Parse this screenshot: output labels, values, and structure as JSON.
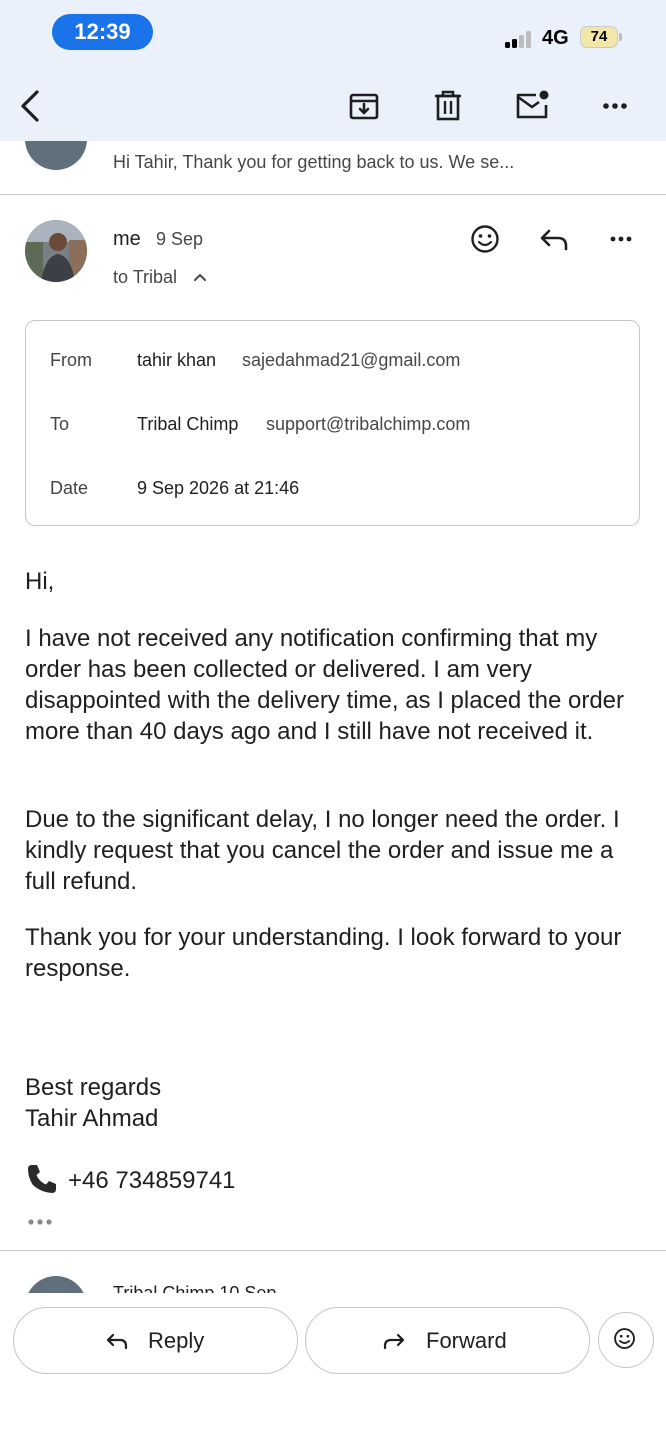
{
  "status_bar": {
    "time": "12:39",
    "network": "4G",
    "battery": "74"
  },
  "toolbar": {
    "back_icon": "chevron-left-icon",
    "archive_icon": "archive-icon",
    "delete_icon": "trash-icon",
    "mark_unread_icon": "mail-unread-icon",
    "more_icon": "more-horizontal-icon"
  },
  "previous_message": {
    "snippet": "Hi Tahir, Thank you for getting back to us. We se..."
  },
  "message": {
    "sender": "me",
    "date": "9 Sep",
    "recipient_summary": "to Tribal",
    "details": {
      "from_label": "From",
      "from_name": "tahir khan",
      "from_email": "sajedahmad21@gmail.com",
      "to_label": "To",
      "to_name": "Tribal Chimp",
      "to_email": "support@tribalchimp.com",
      "date_label": "Date",
      "date_value": "9 Sep 2026 at 21:46"
    },
    "body": {
      "greeting": "Hi,",
      "paragraph1": "I have not received any notification confirming that my order has been collected or delivered. I am very disappointed with the delivery time, as I placed the order more than 40 days ago and I still have not received it.",
      "paragraph2": "Due to the significant delay, I no longer need the order. I kindly request that you cancel the order and issue me a full refund.",
      "paragraph3": "Thank you for your understanding. I look forward to your response.",
      "signoff": "Best regards",
      "signature_name": "Tahir Ahmad",
      "phone": "+46 734859741"
    }
  },
  "next_message": {
    "sender_date": "Tribal Chimp  10 Sep"
  },
  "actions": {
    "reply_label": "Reply",
    "forward_label": "Forward"
  },
  "colors": {
    "accent": "#1a73e8",
    "topbar_bg": "#eaf1fb",
    "border": "#c4c7c5"
  }
}
